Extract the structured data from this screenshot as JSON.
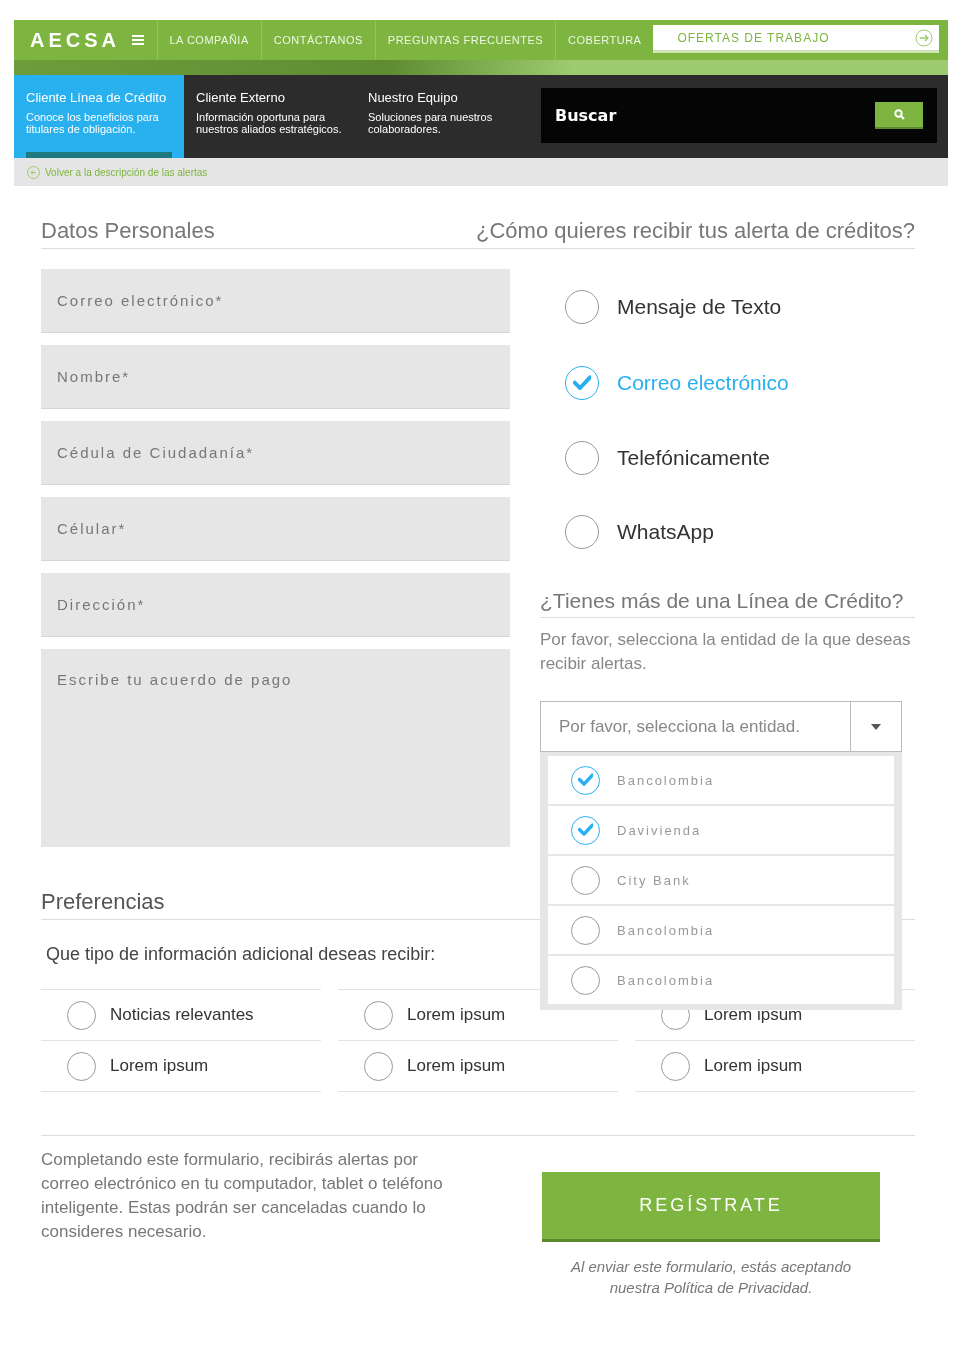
{
  "nav": {
    "logo": "AECSA",
    "items": [
      "LA COMPAÑIA",
      "CONTÁCTANOS",
      "PREGUNTAS FRECUENTES",
      "COBERTURA"
    ],
    "jobs_button": "OFERTAS DE TRABAJO"
  },
  "segments": [
    {
      "title": "Cliente Línea de Crédito",
      "subtitle": "Conoce los beneficios para titulares de obligación.",
      "selected": true
    },
    {
      "title": "Cliente Externo",
      "subtitle": "Información oportuna para nuestros aliados estratégicos.",
      "selected": false
    },
    {
      "title": "Nuestro Equipo",
      "subtitle": "Soluciones para nuestros colaboradores.",
      "selected": false
    }
  ],
  "search": {
    "placeholder": "Buscar"
  },
  "back_link": "Volver a la descripción de las alertas",
  "personal": {
    "title": "Datos Personales",
    "fields": [
      {
        "kind": "input",
        "placeholder": "Correo electrónico*"
      },
      {
        "kind": "input",
        "placeholder": "Nombre*"
      },
      {
        "kind": "input",
        "placeholder": "Cédula de Ciudadanía*"
      },
      {
        "kind": "input",
        "placeholder": "Célular*"
      },
      {
        "kind": "input",
        "placeholder": "Dirección*"
      },
      {
        "kind": "textarea",
        "placeholder": "Escribe tu acuerdo de pago"
      }
    ]
  },
  "delivery": {
    "title": "¿Cómo quieres recibir tus alerta de créditos?",
    "options": [
      {
        "label": "Mensaje de Texto",
        "selected": false
      },
      {
        "label": "Correo electrónico",
        "selected": true
      },
      {
        "label": "Telefónicamente",
        "selected": false
      },
      {
        "label": "WhatsApp",
        "selected": false
      }
    ]
  },
  "entities": {
    "title": "¿Tienes más de una Línea de Crédito?",
    "description": "Por favor, selecciona la entidad de la que deseas recibir alertas.",
    "select": {
      "placeholder": "Por favor, selecciona la entidad.",
      "expanded": true
    },
    "options": [
      {
        "label": "Bancolombia",
        "checked": true
      },
      {
        "label": "Davivienda",
        "checked": true
      },
      {
        "label": "City Bank",
        "checked": false
      },
      {
        "label": "Bancolombia",
        "checked": false
      },
      {
        "label": "Bancolombia",
        "checked": false
      }
    ]
  },
  "preferences": {
    "title": "Preferencias",
    "question": "Que tipo de información adicional deseas recibir:",
    "options": [
      {
        "label": "Noticias relevantes",
        "selected": false
      },
      {
        "label": "Lorem ipsum",
        "selected": false
      },
      {
        "label": "Lorem ipsum",
        "selected": false
      },
      {
        "label": "Lorem ipsum",
        "selected": false
      },
      {
        "label": "Lorem ipsum",
        "selected": false
      },
      {
        "label": "Lorem ipsum",
        "selected": false
      }
    ]
  },
  "footer": {
    "text": "Completando este formulario, recibirás alertas por correo electrónico en tu computador, tablet o teléfono inteligente. Estas podrán ser canceladas cuando lo consideres necesario.",
    "button": "REGÍSTRATE",
    "note": "Al enviar este formulario, estás aceptando nuestra Política de Privacidad."
  }
}
